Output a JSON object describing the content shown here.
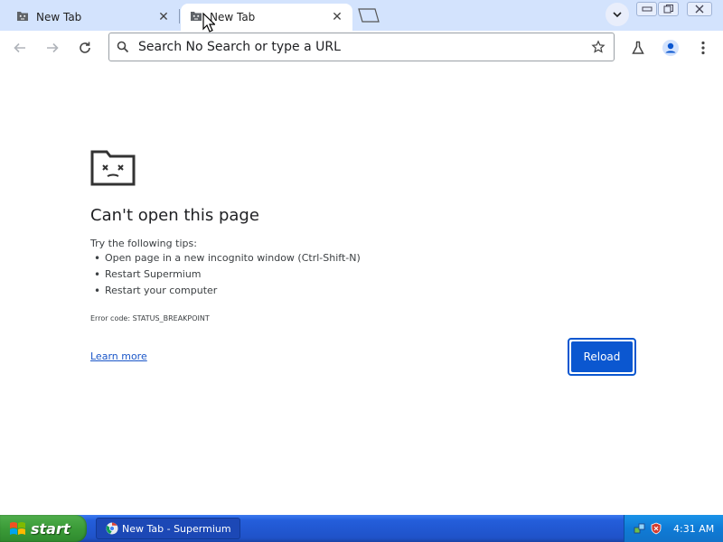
{
  "window": {
    "tabs": [
      {
        "title": "New Tab",
        "active": false
      },
      {
        "title": "New Tab",
        "active": true
      }
    ],
    "close_glyph": "✕"
  },
  "toolbar": {
    "omnibox_placeholder": "Search No Search or type a URL"
  },
  "error_page": {
    "title": "Can't open this page",
    "tips_heading": "Try the following tips:",
    "tips": [
      "Open page in a new incognito window (Ctrl-Shift-N)",
      "Restart Supermium",
      "Restart your computer"
    ],
    "error_code": "Error code: STATUS_BREAKPOINT",
    "learn_more_label": "Learn more",
    "reload_label": "Reload"
  },
  "taskbar": {
    "start_label": "start",
    "task_title": "New Tab - Supermium",
    "clock": "4:31 AM"
  },
  "colors": {
    "tabstrip_bg": "#d3e3fd",
    "accent_blue": "#0b57d0",
    "link_blue": "#1a56c8",
    "taskbar_blue": "#245edb",
    "start_green": "#3b9b38"
  },
  "icons": {
    "tab_favicon": "sad-folder-icon",
    "back": "arrow-left-icon",
    "forward": "arrow-right-icon",
    "reload": "reload-icon",
    "search": "search-icon",
    "bookmark": "star-icon",
    "labs": "flask-icon",
    "profile": "profile-icon",
    "menu": "kebab-menu-icon"
  }
}
